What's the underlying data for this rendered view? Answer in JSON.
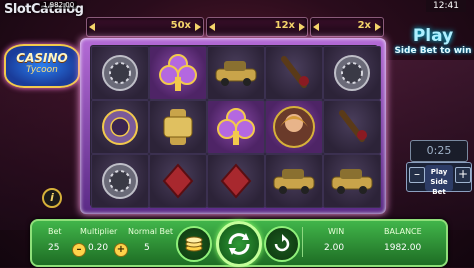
{
  "watermark": {
    "text": "SlotCatalog",
    "tag": "1,982.00"
  },
  "logo": {
    "main": "CASINO",
    "sub": "Tycoon"
  },
  "multipliers": [
    {
      "label": "50x"
    },
    {
      "label": "12x"
    },
    {
      "label": "2x"
    }
  ],
  "clock": "12:41",
  "side_bet": {
    "play_label": "Play",
    "caption": "Side Bet to win",
    "timer": "0:25",
    "button_label": "Play Side Bet",
    "minus": "–",
    "plus": "+"
  },
  "reels": [
    [
      "chip-icon",
      "royal-chip-icon",
      "chip-icon",
      "car-icon",
      "diamond-suit-icon"
    ],
    [
      "clubs-suit-icon",
      "watch-icon",
      "diamond-suit-icon",
      "car-icon",
      "wine-icon"
    ],
    [
      "car-icon",
      "clubs-suit-icon",
      "diamond-suit-icon",
      "wine-icon",
      "car-icon"
    ],
    [
      "wine-icon",
      "lady-icon",
      "car-icon",
      "chip-icon",
      "wine-icon"
    ],
    [
      "chip-icon",
      "wine-icon",
      "car-icon",
      "wine-icon",
      "car-icon"
    ]
  ],
  "info_label": "i",
  "bottom": {
    "bet_label": "Bet",
    "bet_value": "25",
    "multiplier_label": "Multiplier",
    "multiplier_value": "0.20",
    "normal_bet_label": "Normal Bet",
    "normal_bet_value": "5",
    "win_label": "WIN",
    "win_value": "2.00",
    "balance_label": "BALANCE",
    "balance_value": "1982.00",
    "minus": "–",
    "plus": "+"
  },
  "colors": {
    "accent_gold": "#f4d46a",
    "panel_green": "#2f9a36",
    "frame_purple": "#b46bd6",
    "cyan_glow": "#00d8ff"
  }
}
